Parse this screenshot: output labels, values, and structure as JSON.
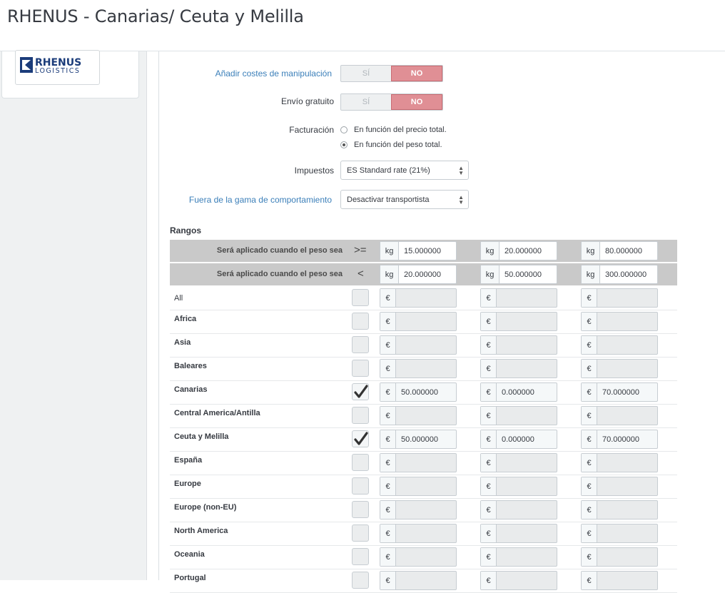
{
  "page_title": "RHENUS - Canarias/ Ceuta y Melilla",
  "logo": {
    "line1": "RHENUS",
    "line2": "LOGISTICS"
  },
  "form": {
    "handling": {
      "label": "Añadir costes de manipulación",
      "yes": "SÍ",
      "no": "NO"
    },
    "free_shipping": {
      "label": "Envío gratuito",
      "yes": "SÍ",
      "no": "NO"
    },
    "billing": {
      "label": "Facturación",
      "option1": "En función del precio total.",
      "option2": "En función del peso total."
    },
    "taxes": {
      "label": "Impuestos",
      "value": "ES Standard rate (21%)"
    },
    "out_of_range": {
      "label": "Fuera de la gama de comportamiento",
      "value": "Desactivar transportista"
    }
  },
  "ranges": {
    "title": "Rangos",
    "unit": "kg",
    "currency": "€",
    "from": {
      "label": "Será aplicado cuando el peso sea",
      "op": ">=",
      "values": [
        "15.000000",
        "20.000000",
        "80.000000"
      ]
    },
    "to": {
      "label": "Será aplicado cuando el peso sea",
      "op": "<",
      "values": [
        "20.000000",
        "50.000000",
        "300.000000"
      ]
    }
  },
  "zones": [
    {
      "name": "All",
      "checked": false,
      "prices": [
        "",
        "",
        ""
      ]
    },
    {
      "name": "Africa",
      "checked": false,
      "prices": [
        "",
        "",
        ""
      ]
    },
    {
      "name": "Asia",
      "checked": false,
      "prices": [
        "",
        "",
        ""
      ]
    },
    {
      "name": "Baleares",
      "checked": false,
      "prices": [
        "",
        "",
        ""
      ]
    },
    {
      "name": "Canarias",
      "checked": true,
      "prices": [
        "50.000000",
        "0.000000",
        "70.000000"
      ]
    },
    {
      "name": "Central America/Antilla",
      "checked": false,
      "prices": [
        "",
        "",
        ""
      ]
    },
    {
      "name": "Ceuta y Melilla",
      "checked": true,
      "prices": [
        "50.000000",
        "0.000000",
        "70.000000"
      ]
    },
    {
      "name": "España",
      "checked": false,
      "prices": [
        "",
        "",
        ""
      ]
    },
    {
      "name": "Europe",
      "checked": false,
      "prices": [
        "",
        "",
        ""
      ]
    },
    {
      "name": "Europe (non-EU)",
      "checked": false,
      "prices": [
        "",
        "",
        ""
      ]
    },
    {
      "name": "North America",
      "checked": false,
      "prices": [
        "",
        "",
        ""
      ]
    },
    {
      "name": "Oceania",
      "checked": false,
      "prices": [
        "",
        "",
        ""
      ]
    },
    {
      "name": "Portugal",
      "checked": false,
      "prices": [
        "",
        "",
        ""
      ]
    }
  ]
}
